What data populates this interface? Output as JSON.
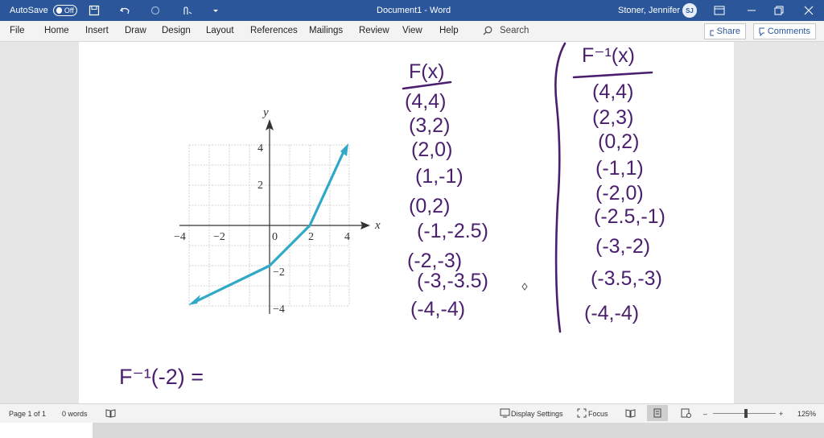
{
  "titlebar": {
    "autosave_label": "AutoSave",
    "autosave_state": "Off",
    "doc_title": "Document1 - Word",
    "user_name": "Stoner, Jennifer L",
    "user_initials": "SJ"
  },
  "ribbon": {
    "tabs": [
      "File",
      "Home",
      "Insert",
      "Draw",
      "Design",
      "Layout",
      "References",
      "Mailings",
      "Review",
      "View",
      "Help"
    ],
    "search_label": "Search",
    "share_label": "Share",
    "comments_label": "Comments"
  },
  "graph": {
    "axis_x_label": "x",
    "axis_y_label": "y",
    "x_ticks": [
      "−4",
      "−2",
      "0",
      "2",
      "4"
    ],
    "y_ticks": [
      "4",
      "2",
      "−2",
      "−4"
    ]
  },
  "handwriting": {
    "f_header": "F(x)",
    "f_points": [
      "(4,4)",
      "(3,2)",
      "(2,0)",
      "(1,-1)",
      "(0,2)",
      "(-1,-2.5)",
      "(-2,-3)",
      "(-3,-3.5)",
      "(-4,-4)"
    ],
    "finv_header": "F⁻¹(x)",
    "finv_points": [
      "(4,4)",
      "(2,3)",
      "(0,2)",
      "(-1,1)",
      "(-2,0)",
      "(-2.5,-1)",
      "(-3,-2)",
      "(-3.5,-3)",
      "(-4,-4)"
    ],
    "question": "F⁻¹(-2) ="
  },
  "statusbar": {
    "page": "Page 1 of 1",
    "words": "0 words",
    "display_settings": "Display Settings",
    "focus": "Focus",
    "zoom": "125%"
  },
  "colors": {
    "title_bg": "#2b579a",
    "curve": "#2fa9c5",
    "ink": "#4a1f6e"
  }
}
